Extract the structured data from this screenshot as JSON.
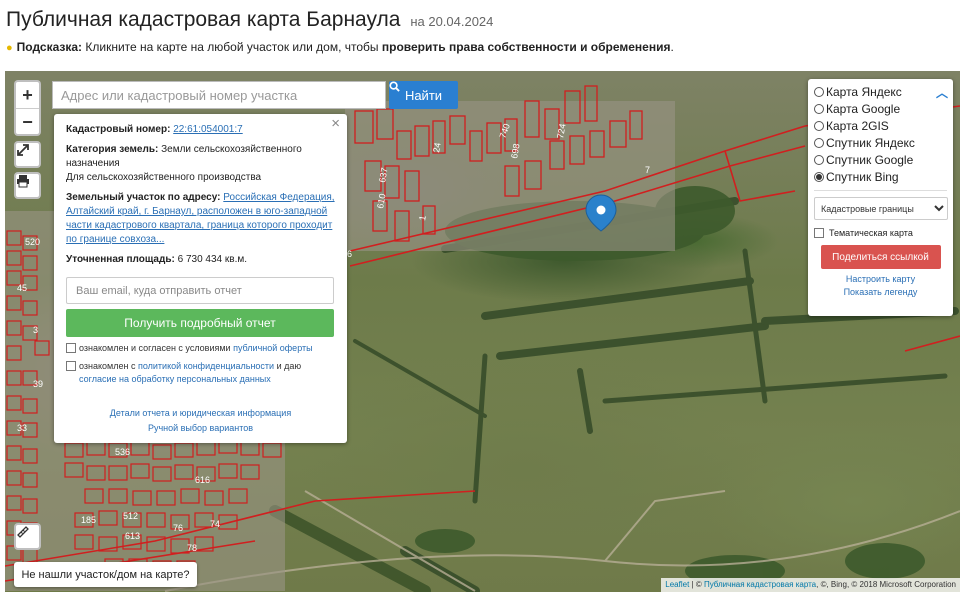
{
  "header": {
    "title": "Публичная кадастровая карта Барнаула",
    "date": "на 20.04.2024",
    "hint_label": "Подсказка:",
    "hint_text": " Кликните на карте на любой участок или дом, чтобы ",
    "hint_bold": "проверить права собственности и обременения",
    "hint_end": "."
  },
  "map": {
    "zoom_in": "+",
    "zoom_out": "−",
    "search_placeholder": "Адрес или кадастровый номер участка",
    "search_button": "Найти",
    "not_found_button": "Не нашли участок/дом на карте?",
    "plot_numbers": [
      "740",
      "724",
      "698",
      "637",
      "610",
      "520",
      "536",
      "616",
      "512",
      "613",
      "185",
      "76",
      "78",
      "74",
      "39",
      "24",
      "7",
      "6",
      "1",
      "45",
      "3",
      "33"
    ],
    "attribution": {
      "leaflet": "Leaflet",
      "sep1": " | © ",
      "pkk": "Публичная кадастровая карта",
      "rest": ", ©, Bing, © 2018 Microsoft Corporation"
    }
  },
  "info_panel": {
    "close": "×",
    "cadastral_label": "Кадастровый номер:",
    "cadastral_value": "22:61:054001:7",
    "land_category_label": "Категория земель:",
    "land_category_value": "Земли сельскохозяйственного назначения",
    "land_use": "Для сельскохозяйственного производства",
    "address_label": "Земельный участок по адресу:",
    "address_value": "Российская Федерация, Алтайский край, г. Барнаул, расположен в юго-западной части кадастрового квартала, граница которого проходит по границе совхоза...",
    "area_label": "Уточненная площадь:",
    "area_value": "6 730 434 кв.м.",
    "email_placeholder": "Ваш email, куда отправить отчет",
    "report_button": "Получить подробный отчет",
    "consent1_text": "ознакомлен и согласен с условиями ",
    "consent1_link": "публичной оферты",
    "consent2_text": "ознакомлен с ",
    "consent2_link1": "политикой конфиденциальности",
    "consent2_mid": " и даю ",
    "consent2_link2": "согласие на обработку персональных данных",
    "details_link": "Детали отчета и юридическая информация",
    "manual_link": "Ручной выбор вариантов"
  },
  "layers": {
    "options": [
      {
        "label": "Карта Яндекс",
        "selected": false
      },
      {
        "label": "Карта Google",
        "selected": false
      },
      {
        "label": "Карта 2GIS",
        "selected": false
      },
      {
        "label": "Спутник Яндекс",
        "selected": false
      },
      {
        "label": "Спутник Google",
        "selected": false
      },
      {
        "label": "Спутник Bing",
        "selected": true
      }
    ],
    "overlay_select": "Кадастровые границы",
    "thematic_label": "Тематическая карта",
    "share_button": "Поделиться ссылкой",
    "configure_link": "Настроить карту",
    "legend_link": "Показать легенду"
  },
  "colors": {
    "boundary": "#d11f1f",
    "accent": "#2a7fd1",
    "success": "#5cb85c",
    "danger": "#d9534f"
  }
}
